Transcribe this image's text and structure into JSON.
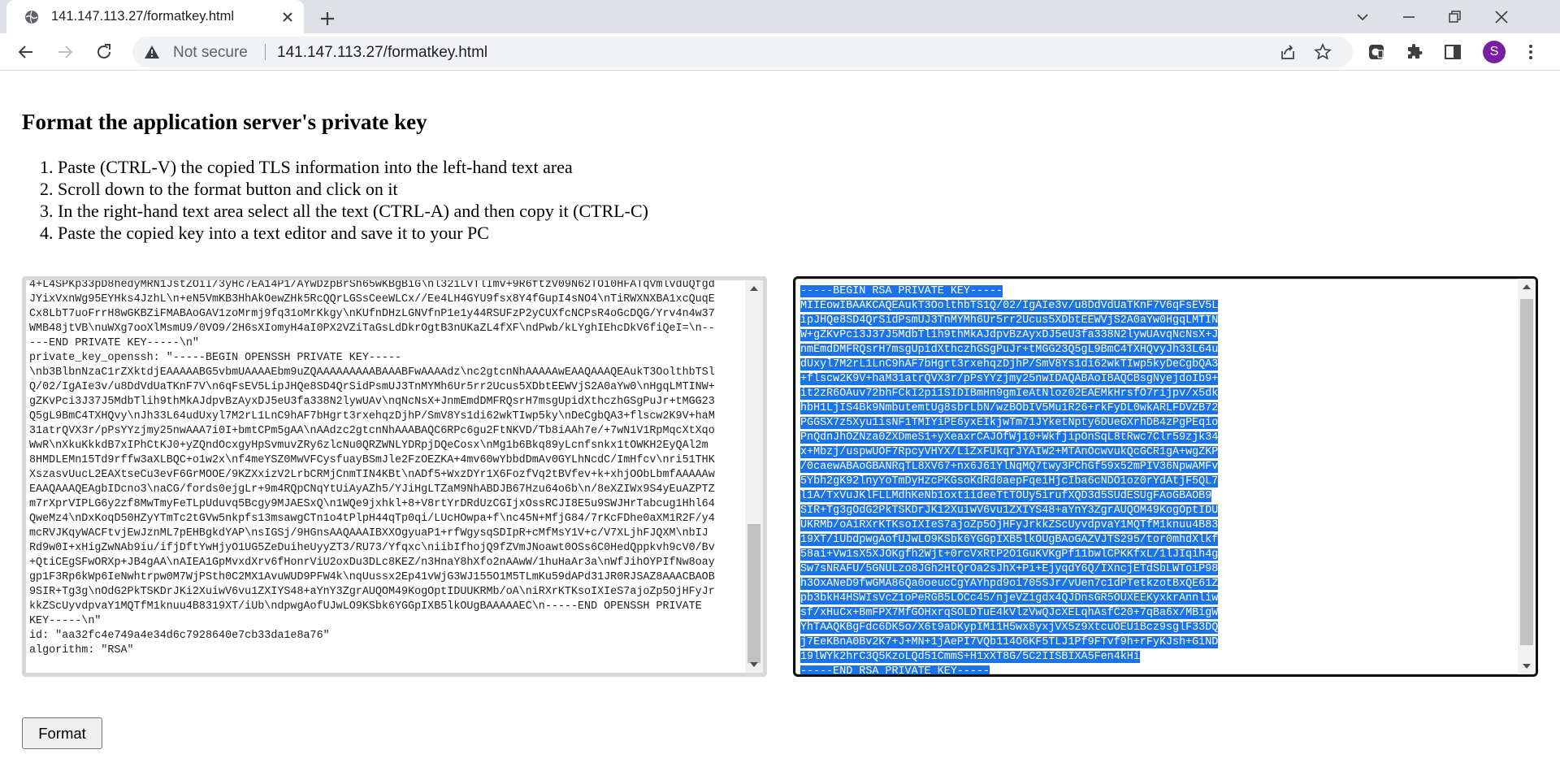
{
  "browser": {
    "tab_title": "141.147.113.27/formatkey.html",
    "security_label": "Not secure",
    "url": "141.147.113.27/formatkey.html",
    "profile_initial": "S"
  },
  "page": {
    "heading": "Format the application server's private key",
    "steps": [
      "Paste (CTRL-V) the copied TLS information into the left-hand text area",
      "Scroll down to the format button and click on it",
      "In the right-hand text area select all the text (CTRL-A) and then copy it (CTRL-C)",
      "Paste the copied key into a text editor and save it to your PC"
    ],
    "input_text": [
      "4+L4SPKp33pD8hedyMRN1JstZOiI/3yHc7EA14P1/AYwDzpBrSh65wKBgBiG\\nl32iLvTlImv+9R6ftzV09N62TOi0HFATqVmlvduQfgd",
      "JYixVxnWg95EYHks4JzhL\\n+eN5VmKB3HhAkOewZHk5RcQQrLGSsCeeWLCx//Ee4LH4GYU9fsx8Y4fGupI4sNO4\\nTiRWXNXBA1xcQuqE",
      "Cx8LbT7uoFrrH8wGKBZiFMABAoGAV1zoMrmj9fq31oMrKkgy\\nKUfnDHzLGNVfnP1e1y44RSUFzP2yCUXfcNCPsR4oGcDQG/Yrv4n4w37",
      "WMB48jtVB\\nuWXg7ooXlMsmU9/0VO9/2H6sXIomyH4aI0PX2VZiTaGsLdDkrOgtB3nUKaZL4fXF\\ndPwb/kLYghIEhcDkV6fiQeI=\\n--",
      "---END PRIVATE KEY-----\\n\"",
      "private_key_openssh: \"-----BEGIN OPENSSH PRIVATE KEY-----",
      "\\nb3BlbnNzaC1rZXktdjEAAAAABG5vbmUAAAAEbm9uZQAAAAAAAAABAAABFwAAAAdz\\nc2gtcnNhAAAAAwEAAQAAAQEAukT3OolthbTSl",
      "Q/02/IgAIe3v/u8DdVdUaTKnF7V\\n6qFsEV5LipJHQe8SD4QrSidPsmUJ3TnMYMh6Ur5rr2Ucus5XDbtEEWVjS2A0aYw0\\nHgqLMTINW+",
      "gZKvPci3J37J5MdbTlih9thMkAJdpvBzAyxDJ5eU3fa338N2lywUAv\\nqNcNsX+JnmEmdDMFRQsrH7msgUpidXthczhGSgPuJr+tMGG23",
      "Q5gL9BmC4TXHQvy\\nJh33L64udUxyl7M2rL1LnC9hAF7bHgrt3rxehqzDjhP/SmV8Ys1di62wkTIwp5ky\\nDeCgbQA3+flscw2K9V+haM",
      "31atrQVX3r/pPsYYzjmy25nwAAA7i0I+bmtCPm5gAA\\nAAdzc2gtcnNhAAABAQC6RPc6gu2FtNKVD/Tb8iAAh7e/+7wN1V1RpMqcXtXqo",
      "WwR\\nXkuKkkdB7xIPhCtKJ0+yZQndOcxgyHpSvmuvZRy6zlcNu0QRZWNLYDRpjDQeCosx\\nMg1b6Bkq89yLcnfsnkx1tOWKH2EyQAl2m",
      "8HMDLEMn15Td9rffw3aXLBQC+o1w2x\\nf4meYSZ0MwVFCysfuayBSmJle2FzOEZKA+4mv60wYbbdDmAv0GYLhNcdC/ImHfcv\\nri51THK",
      "XszasvUucL2EAXtseCu3evF6GrMOOE/9KZXxizV2LrbCRMjCnmTIN4KBt\\nADf5+WxzDYr1X6FozfVq2tBVfev+k+xhjOObLbmfAAAAAw",
      "EAAQAAAQEAgbIDcno3\\naCG/fords0ejgLr+9m4RQpCNqYtUiAyAZh5/YJiHgLTZaM9NhABDJB67Hzu64o6b\\n/8eXZIWx9S4yEuAZPTZ",
      "m7rXprVIPLG6y2zf8MwTmyFeTLpUduvq5Bcgy9MJAESxQ\\n1WQe9jxhkl+8+V8rtYrDRdUzCGIjxOssRCJI8E5u9SWJHrTabcug1Hhl64",
      "QweMz4\\nDxKoqD50HZyYTmTc2tGVw5nkpfs13msawgCTn1o4tPlpH44qTp0qi/LUcHOwpa+f\\nc45N+MfjG84/7rKcFDhe0aXM1R2F/y4",
      "mcRVJKqyWACFtvjEwJznML7pEHBgkdYAP\\nsIGSj/9HGnsAAQAAAIBXXOgyuaP1+rfWgysqSDIpR+cMfMsY1V+c/V7XLjhFJQXM\\nbIJ",
      "Rd9w0I+xHigZwNAb9iu/ifjDftYwHjyO1UG5ZeDuiheUyyZT3/RU73/Yfqxc\\niibIfhojQ9fZVmJNoawt0OSs6C0HedQppkvh9cV0/Bv",
      "+QtiCEgSFwORXp+JB4gAA\\nAIEA1GpMvxdXrv6fHonrViU2oxDu3DLc8KEZ/n3HnaY8hXfo2nAAwW/1huHaAr3a\\nWfJihOYPIfNw8oay",
      "gp1F3Rp6kWp6IeNwhtrpw0M7WjPSth0C2MX1AvuWUD9PFW4k\\nqUussx2Ep41vWjG3WJ155O1M5TLmKu59dAPd31JR0RJSAZ8AAACBAOB",
      "9SIR+Tg3g\\nOdG2PkTSKDrJKi2XuiwV6vu1ZXIYS48+aYnY3ZgrAUQOM49KogOptIDUUKRMb/oA\\niRXrKTKsoIXIeS7ajoZp5OjHFyJr",
      "kkZScUyvdpvaY1MQTfM1knuu4B8319XT/iUb\\ndpwgAofUJwLO9KSbk6YGGpIXB5lkOUgBAAAAAEC\\n-----END OPENSSH PRIVATE",
      "KEY-----\\n\"",
      "id: \"aa32fc4e749a4e34d6c7928640e7cb33da1e8a76\"",
      "algorithm: \"RSA\""
    ],
    "output_text": [
      "-----BEGIN RSA PRIVATE KEY-----",
      "MIIEowIBAAKCAQEAukT3OolthbTS1Q/02/IgAIe3v/u8DdVdUaTKnF7V6qFsEV5L",
      "ipJHQe8SD4QrSidPsmUJ3TnMYMh6Ur5rr2Ucus5XDbtEEWVjS2A0aYw0HgqLMTIN",
      "W+gZKvPci3J37J5MdbTlih9thMkAJdpvBzAyxDJ5eU3fa338N2lywUAvqNcNsX+J",
      "nmEmdDMFRQsrH7msgUpidXthczhGSgPuJr+tMGG23Q5gL9BmC4TXHQvyJh33L64u",
      "dUxyl7M2rL1LnC9hAF7bHgrt3rxehqzDjhP/SmV8Ys1di62wkTIwp5kyDeCgbQA3",
      "+flscw2K9V+haM31atrQVX3r/pPsYYzjmy25nwIDAQABAoIBAQCBsgNyejdoIb9+",
      "it2zR6OAuv72bhFCkI2pi1SIDIBmHn9gmIeAtNloz02EAEMkHrsfO7rijpv/x5dk",
      "hbH1LjIS4Bk9NmbutemtUg8sbrLbN/wzBObIV5Mu1R26+rkFyDL0wkARLFDVZB72",
      "PGGSX7z5Xyu1isNF1TMIYiPE6yxEIkjwTm71JYketNpty6DUeGXrhDB4zPgPEqio",
      "PnQdnJhOZNza0ZXDmeS1+yXeaxrCAJOfWji0+WkfjipOnSqL8tRwc7Clr59zjk34",
      "x+Mbzj/uspwUOF7RpcyVHYX/LiZxFUkqrJYAIW2+MTAnOcwvukQcGCR1gA+wgZKP",
      "/0caewABAoGBANRqTL8XV67+nx6J61YlNqMQ7twy3PChGf59x52mPIV36NpwAMFv",
      "5Ybh2gK92lnyYoTmDyHzcPKGsoKdRd0aepFqeiHjcIba6cNDO1oz0rYdAtjF5QL7",
      "l1A/TxVuJKlFLLMdhKeNb1oxt1ideeTtTOUy5irufXQD3d5SUdESUgFAoGBAOB9",
      "SIR+Tg3gOdG2PkTSKDrJKi2XuiwV6vu1ZXIYS48+aYnY3ZgrAUQOM49KogOptIDU",
      "UKRMb/oAiRXrKTKsoIXIeS7ajoZp5OjHFyJrkkZScUyvdpvaY1MQTfM1knuu4B83",
      "19XT/iUbdpwgAofUJwLO9KSbk6YGGpIXB5lkOUgBAoGAZVJTS295/tor0mhdXlkf",
      "58ai+Vw1sX5XJOKgfh2Wjt+0rcVxRtP2O1GuKVKgPf11bwlCPKKfxL/1lJIqih4g",
      "Sw7sNRAFU/5GNULzo8JGh2HtQrOa2sJhX+Pi+EjyqdY6Q/IXncjETdSbLWToiP98",
      "h3OxANeD9fwGMA86Qa0oeucCgYAYhpd9oi705SJr/vUen7c1dPTetkzotBxQE61Z",
      "pb3bkH4HSWIsVcZ1oPeRGB5LOCc45/njeVZigdx4QJDnsGR5OUXEEKyxkrAnnliw",
      "sf/xHuCx+BmFPX7MfGOHxrqSOLDTuE4kVlzVwQJcXELqhAsfC20+7qBa6x/MBigW",
      "YhTAAQKBgFdc6DK5o/X6t9aDKypIMi1H5wx8yxjVX5z9XtcuOEU1Bcz9sglF33DQ",
      "j7EeKBnA0Bv2K7+J+MN+1jAePI7VQb114O6KF5TLJ1Pf9FTvf9h+rFyKJsh+GiND",
      "19lWYk2hrC3Q5KzoLQd51CmmS+H1xXT8G/5C2IISBIXA5Fen4kHi",
      "-----END RSA PRIVATE KEY-----"
    ],
    "format_button": "Format"
  }
}
